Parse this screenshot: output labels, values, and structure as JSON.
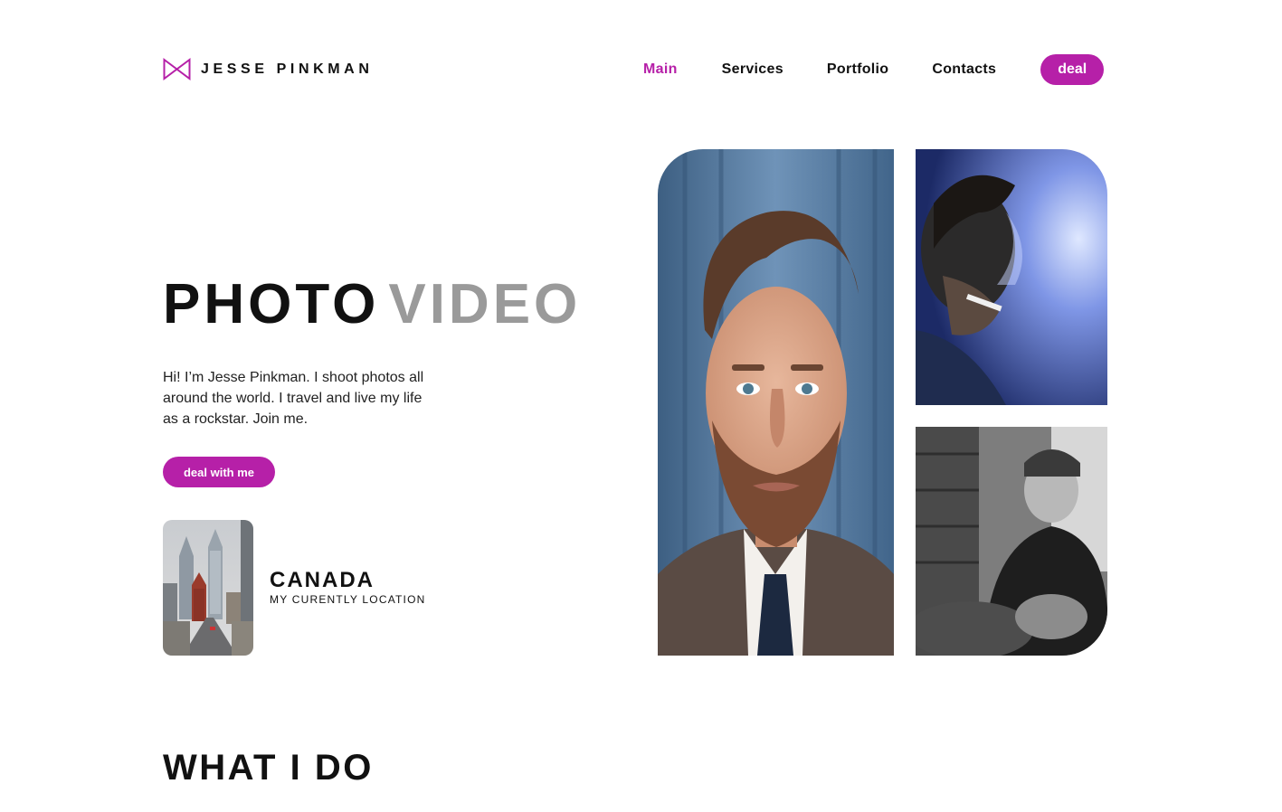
{
  "header": {
    "logo_text": "JESSE PINKMAN",
    "nav": {
      "main": "Main",
      "services": "Services",
      "portfolio": "Portfolio",
      "contacts": "Contacts"
    },
    "deal_label": "deal",
    "active_item": "Main"
  },
  "hero": {
    "title_word1": "PHOTO",
    "title_word2": "VIDEO",
    "description": "Hi! I’m Jesse Pinkman. I shoot photos all around the world. I travel and live my life as a rockstar. Join me.",
    "cta_label": "deal with me"
  },
  "location": {
    "country": "CANADA",
    "caption": "MY CURENTLY LOCATION"
  },
  "sections": {
    "what_i_do": "WHAT I DO"
  },
  "icons": {
    "logo": "bowtie-icon"
  },
  "colors": {
    "accent": "#b620a8",
    "muted_title": "#9a9a9a",
    "text": "#111111",
    "background": "#ffffff"
  }
}
